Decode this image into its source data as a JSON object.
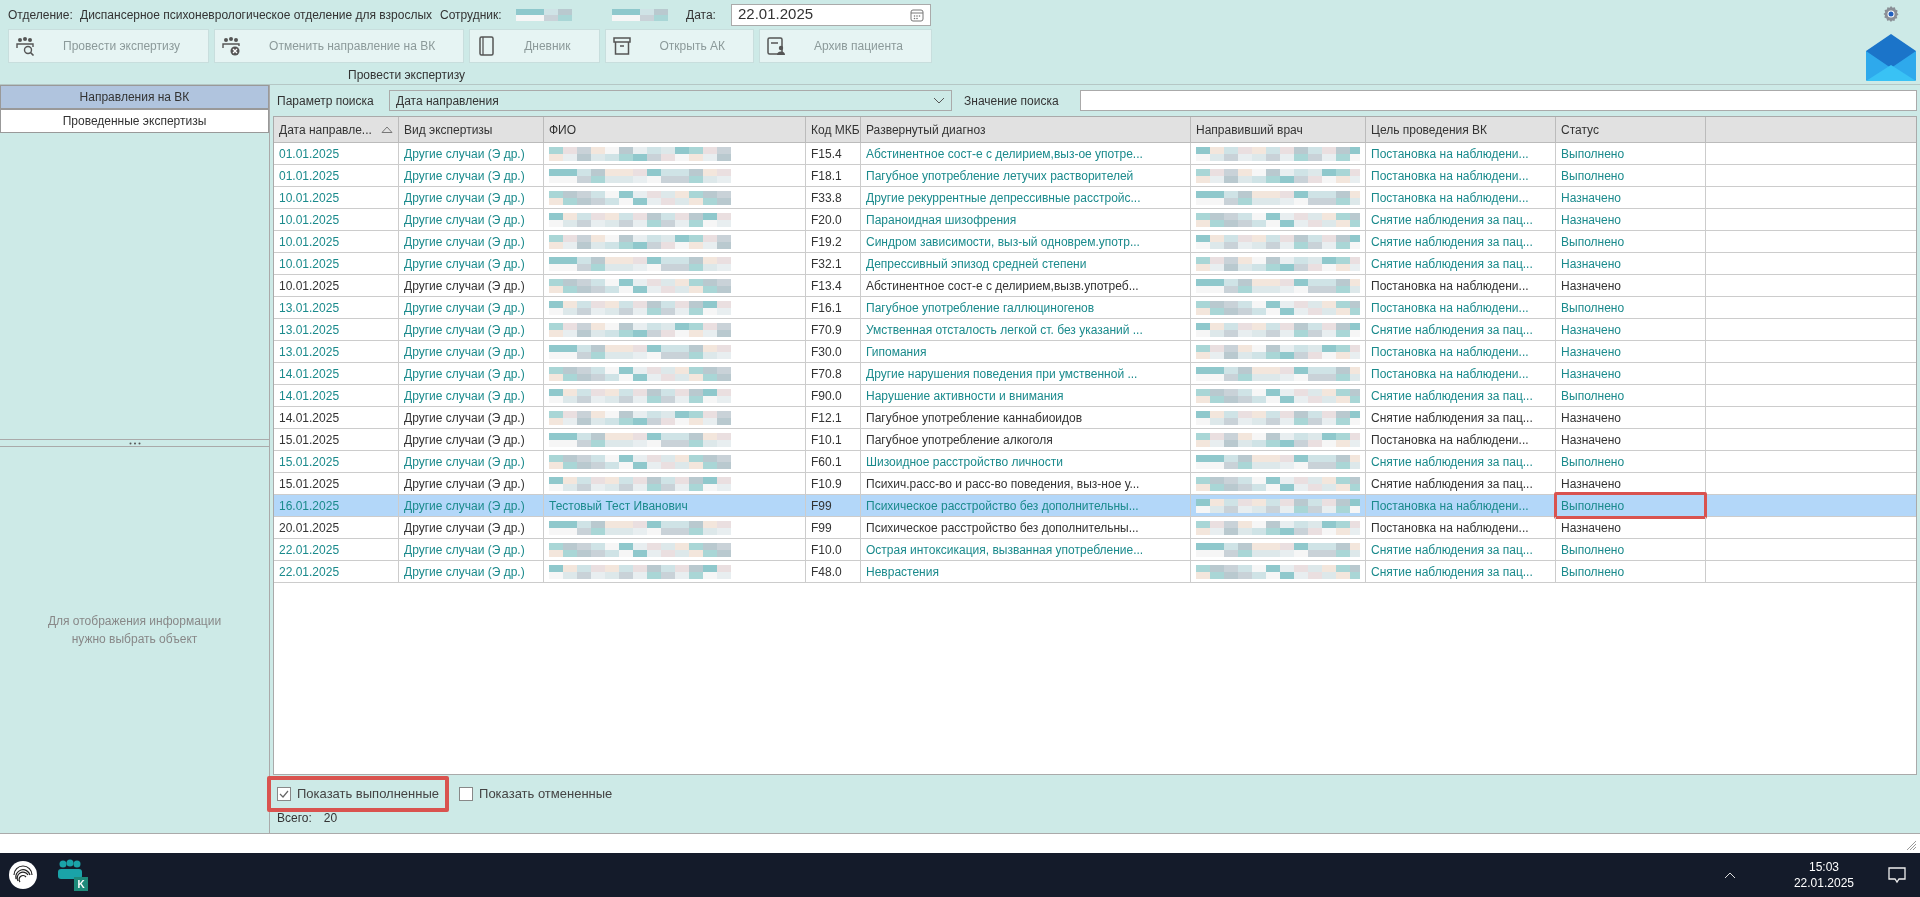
{
  "header": {
    "department_label": "Отделение:",
    "department": "Диспансерное психоневрологическое отделение для взрослых",
    "employee_label": "Сотрудник:",
    "date_label": "Дата:",
    "date": "22.01.2025"
  },
  "toolbar": [
    {
      "kind": "people-search",
      "label": "Провести экспертизу",
      "disabled": true
    },
    {
      "kind": "people-cancel",
      "label": "Отменить направление на ВК",
      "disabled": true
    },
    {
      "kind": "book",
      "label": "Дневник",
      "disabled": true
    },
    {
      "kind": "archive",
      "label": "Открыть АК",
      "disabled": true
    },
    {
      "kind": "person-card",
      "label": "Архив пациента",
      "disabled": true
    }
  ],
  "toolbar_caption": "Провести экспертизу",
  "left_tabs": [
    {
      "label": "Направления на ВК",
      "selected": true
    },
    {
      "label": "Проведенные экспертизы",
      "selected": false
    }
  ],
  "left_message": "Для отображения информации нужно выбрать объект",
  "search": {
    "param_label": "Параметр поиска",
    "param_value": "Дата направления",
    "value_label": "Значение поиска"
  },
  "table": {
    "columns": [
      {
        "label": "Дата направле...",
        "sorted": true
      },
      {
        "label": "Вид экспертизы",
        "sorted": false
      },
      {
        "label": "ФИО",
        "sorted": false
      },
      {
        "label": "Код МКБ",
        "sorted": false
      },
      {
        "label": "Развернутый диагноз",
        "sorted": false
      },
      {
        "label": "Направивший врач",
        "sorted": false
      },
      {
        "label": "Цель проведения ВК",
        "sorted": false
      },
      {
        "label": "Статус",
        "sorted": false
      }
    ],
    "rows": [
      {
        "date": "01.01.2025",
        "type": "Другие случаи (Э др.)",
        "code": "F15.4",
        "diagnosis": "Абстинентное сост-е с делирием,выз-ое употре...",
        "goal": "Постановка на наблюдени...",
        "status": "Выполнено",
        "color": "#1a8a8c",
        "selected": false,
        "marked": false
      },
      {
        "date": "01.01.2025",
        "type": "Другие случаи (Э др.)",
        "code": "F18.1",
        "diagnosis": "Пагубное употребление летучих растворителей",
        "goal": "Постановка на наблюдени...",
        "status": "Выполнено",
        "color": "#1a8a8c",
        "selected": false,
        "marked": false
      },
      {
        "date": "10.01.2025",
        "type": "Другие случаи (Э др.)",
        "code": "F33.8",
        "diagnosis": "Другие рекуррентные депрессивные расстройс...",
        "goal": "Постановка на наблюдени...",
        "status": "Назначено",
        "color": "#1a8a8c",
        "selected": false,
        "marked": false
      },
      {
        "date": "10.01.2025",
        "type": "Другие случаи (Э др.)",
        "code": "F20.0",
        "diagnosis": "Параноидная шизофрения",
        "goal": "Снятие наблюдения за пац...",
        "status": "Назначено",
        "color": "#1a8a8c",
        "selected": false,
        "marked": false
      },
      {
        "date": "10.01.2025",
        "type": "Другие случаи (Э др.)",
        "code": "F19.2",
        "diagnosis": "Синдром зависимости, выз-ый одноврем.употр...",
        "goal": "Снятие наблюдения за пац...",
        "status": "Выполнено",
        "color": "#1a8a8c",
        "selected": false,
        "marked": false
      },
      {
        "date": "10.01.2025",
        "type": "Другие случаи (Э др.)",
        "code": "F32.1",
        "diagnosis": "Депрессивный эпизод средней степени",
        "goal": "Снятие наблюдения за пац...",
        "status": "Назначено",
        "color": "#1a8a8c",
        "selected": false,
        "marked": false
      },
      {
        "date": "10.01.2025",
        "type": "Другие случаи (Э др.)",
        "code": "F13.4",
        "diagnosis": "Абстинентное сост-е с делирием,вызв.употреб...",
        "goal": "Постановка на наблюдени...",
        "status": "Назначено",
        "color": "#333333",
        "selected": false,
        "marked": false
      },
      {
        "date": "13.01.2025",
        "type": "Другие случаи (Э др.)",
        "code": "F16.1",
        "diagnosis": "Пагубное употребление галлюциногенов",
        "goal": "Постановка на наблюдени...",
        "status": "Выполнено",
        "color": "#1a8a8c",
        "selected": false,
        "marked": false
      },
      {
        "date": "13.01.2025",
        "type": "Другие случаи (Э др.)",
        "code": "F70.9",
        "diagnosis": "Умственная отсталость легкой ст. без указаний ...",
        "goal": "Снятие наблюдения за пац...",
        "status": "Назначено",
        "color": "#1a8a8c",
        "selected": false,
        "marked": false
      },
      {
        "date": "13.01.2025",
        "type": "Другие случаи (Э др.)",
        "code": "F30.0",
        "diagnosis": "Гипомания",
        "goal": "Постановка на наблюдени...",
        "status": "Назначено",
        "color": "#1a8a8c",
        "selected": false,
        "marked": false
      },
      {
        "date": "14.01.2025",
        "type": "Другие случаи (Э др.)",
        "code": "F70.8",
        "diagnosis": "Другие нарушения поведения при умственной ...",
        "goal": "Постановка на наблюдени...",
        "status": "Назначено",
        "color": "#1a8a8c",
        "selected": false,
        "marked": false
      },
      {
        "date": "14.01.2025",
        "type": "Другие случаи (Э др.)",
        "code": "F90.0",
        "diagnosis": "Нарушение активности и внимания",
        "goal": "Снятие наблюдения за пац...",
        "status": "Выполнено",
        "color": "#1a8a8c",
        "selected": false,
        "marked": false
      },
      {
        "date": "14.01.2025",
        "type": "Другие случаи (Э др.)",
        "code": "F12.1",
        "diagnosis": "Пагубное употребление каннабиоидов",
        "goal": "Снятие наблюдения за пац...",
        "status": "Назначено",
        "color": "#333333",
        "selected": false,
        "marked": false
      },
      {
        "date": "15.01.2025",
        "type": "Другие случаи (Э др.)",
        "code": "F10.1",
        "diagnosis": "Пагубное употребление алкоголя",
        "goal": "Постановка на наблюдени...",
        "status": "Назначено",
        "color": "#333333",
        "selected": false,
        "marked": false
      },
      {
        "date": "15.01.2025",
        "type": "Другие случаи (Э др.)",
        "code": "F60.1",
        "diagnosis": "Шизоидное расстройство личности",
        "goal": "Снятие наблюдения за пац...",
        "status": "Выполнено",
        "color": "#1a8a8c",
        "selected": false,
        "marked": false
      },
      {
        "date": "15.01.2025",
        "type": "Другие случаи (Э др.)",
        "code": "F10.9",
        "diagnosis": "Психич.расс-во и расс-во поведения, выз-ное у...",
        "goal": "Снятие наблюдения за пац...",
        "status": "Назначено",
        "color": "#333333",
        "selected": false,
        "marked": false
      },
      {
        "date": "16.01.2025",
        "type": "Другие случаи (Э др.)",
        "fio": "Тестовый Тест Иванович",
        "code": "F99",
        "diagnosis": "Психическое расстройство без дополнительны...",
        "goal": "Постановка на наблюдени...",
        "status": "Выполнено",
        "color": "#1a8a8c",
        "selected": true,
        "marked": true
      },
      {
        "date": "20.01.2025",
        "type": "Другие случаи (Э др.)",
        "code": "F99",
        "diagnosis": "Психическое расстройство без дополнительны...",
        "goal": "Постановка на наблюдени...",
        "status": "Назначено",
        "color": "#333333",
        "selected": false,
        "marked": false
      },
      {
        "date": "22.01.2025",
        "type": "Другие случаи (Э др.)",
        "code": "F10.0",
        "diagnosis": "Острая интоксикация, вызванная употребление...",
        "goal": "Снятие наблюдения за пац...",
        "status": "Выполнено",
        "color": "#1a8a8c",
        "selected": false,
        "marked": false
      },
      {
        "date": "22.01.2025",
        "type": "Другие случаи (Э др.)",
        "code": "F48.0",
        "diagnosis": "Неврастения",
        "goal": "Снятие наблюдения за пац...",
        "status": "Выполнено",
        "color": "#1a8a8c",
        "selected": false,
        "marked": false
      }
    ]
  },
  "filters": [
    {
      "label": "Показать выполненные",
      "checked": true,
      "marked": true
    },
    {
      "label": "Показать отмененные",
      "checked": false,
      "marked": false
    }
  ],
  "total": {
    "label": "Всего:",
    "value": "20"
  },
  "taskbar": {
    "apps": [
      {
        "kind": "fingerprint"
      },
      {
        "kind": "team",
        "badge": "K"
      }
    ],
    "time": "15:03",
    "date": "22.01.2025"
  }
}
